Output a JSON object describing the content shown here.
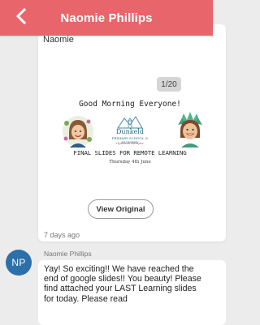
{
  "header": {
    "title": "Naomie Phillips",
    "back_icon": "chevron-left-icon",
    "background": "#e8666b"
  },
  "post": {
    "author": "Naomie",
    "page_indicator": "1/20",
    "slide": {
      "heading": "Good Morning Everyone!",
      "subheading": "FINAL SLIDES FOR REMOTE LEARNING",
      "date": "Thursday 4th June",
      "logo_name": "Dunkeld",
      "logo_tagline": "PRIMARY SCHOOL & NURSERY",
      "logo_motto": "Optimus Semper"
    },
    "view_original_label": "View Original",
    "timestamp": "7 days ago"
  },
  "message": {
    "avatar_initials": "NP",
    "avatar_color": "#2d6fa8",
    "sender": "Naomie Phillips",
    "text": "Yay! So exciting!! We have reached the end of google slides!! You beauty! Please find attached your LAST Learning slides for today. Please read"
  }
}
